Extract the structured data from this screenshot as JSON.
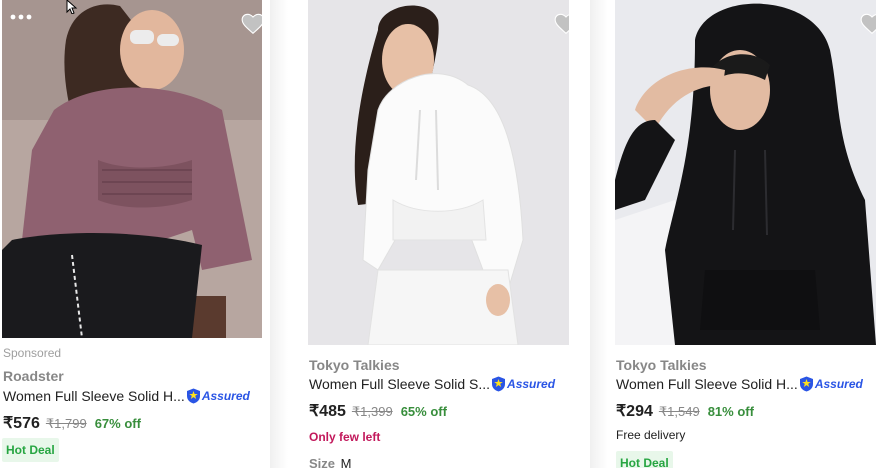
{
  "products": [
    {
      "sponsored_label": "Sponsored",
      "brand": "Roadster",
      "title": "Women Full Sleeve Solid H...",
      "assured_label": "Assured",
      "price": "₹576",
      "mrp": "₹1,799",
      "discount": "67% off",
      "badge": "Hot Deal",
      "image_alt": "woman in mauve velour smocked hoodie",
      "wishlist_icon": "heart-icon"
    },
    {
      "brand": "Tokyo Talkies",
      "title": "Women Full Sleeve Solid S...",
      "assured_label": "Assured",
      "price": "₹485",
      "mrp": "₹1,399",
      "discount": "65% off",
      "stock_note": "Only few left",
      "size_label": "Size",
      "size_value": "M",
      "image_alt": "woman in white hoodie and white joggers",
      "wishlist_icon": "heart-icon"
    },
    {
      "brand": "Tokyo Talkies",
      "title": "Women Full Sleeve Solid H...",
      "assured_label": "Assured",
      "price": "₹294",
      "mrp": "₹1,549",
      "discount": "81% off",
      "delivery_note": "Free delivery",
      "badge": "Hot Deal",
      "image_alt": "woman in black hoodie with hood up",
      "wishlist_icon": "heart-icon"
    }
  ],
  "colors": {
    "price": "#212121",
    "mrp": "#878787",
    "discount": "#388e3c",
    "assured": "#2a55e5",
    "hot_deal_bg": "#e8f7ea",
    "hot_deal_text": "#26a541",
    "stock_note": "#c2185b",
    "wishlist_heart": "#c2c2c2"
  },
  "icons": {
    "more_menu": "more-dots-icon",
    "cursor": "mouse-cursor-icon",
    "assured": "assured-shield-icon"
  }
}
